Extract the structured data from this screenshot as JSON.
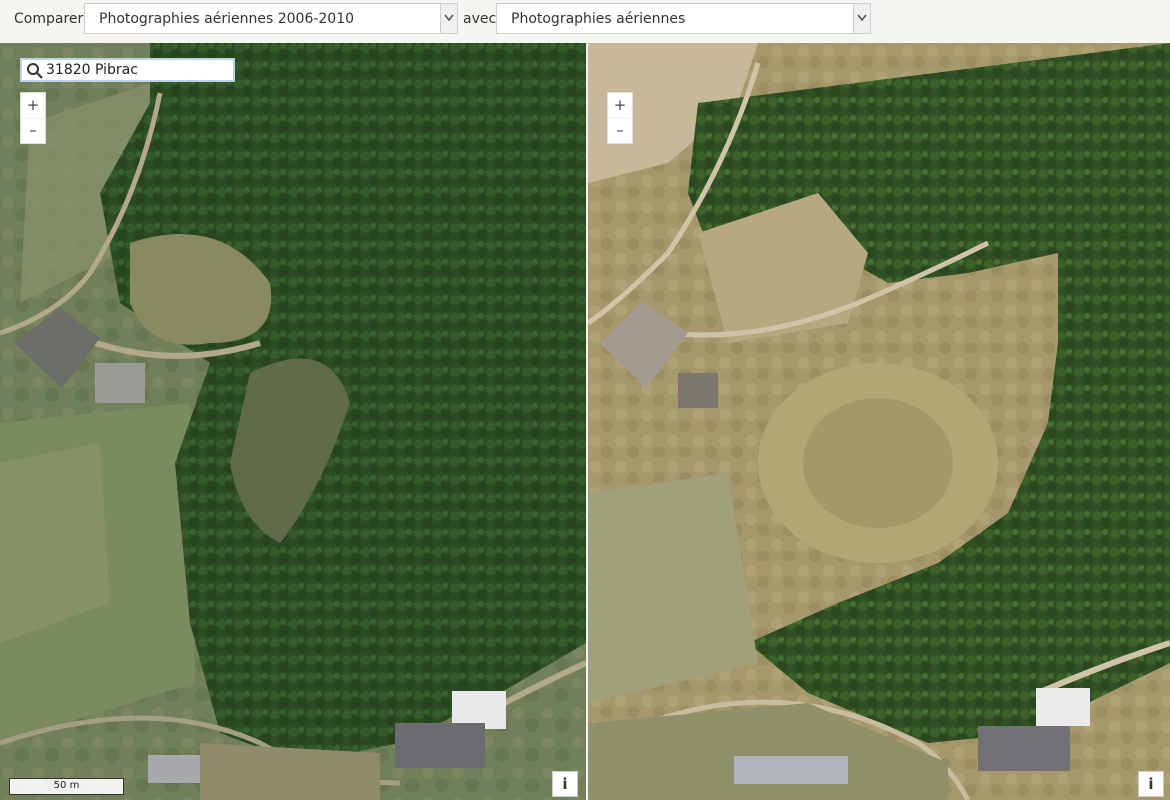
{
  "toolbar": {
    "compare_label": "Comparer",
    "left_select": {
      "selected": "Photographies aériennes 2006-2010"
    },
    "with_label": "avec",
    "right_select": {
      "selected": "Photographies aériennes"
    }
  },
  "search": {
    "value": "31820 Pibrac"
  },
  "zoom": {
    "in_label": "+",
    "out_label": "–"
  },
  "info_label": "i",
  "scale_bar": {
    "label": "50 m"
  },
  "colors": {
    "forest_dark": "#2a4a22",
    "forest_light": "#3e6530",
    "dry_grass": "#a89a6a",
    "roof_white": "#e8e8e8"
  }
}
